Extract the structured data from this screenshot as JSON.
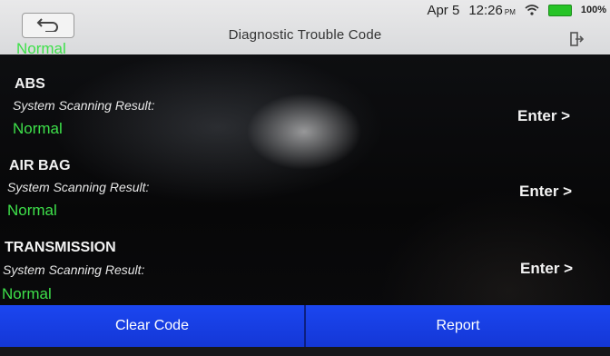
{
  "status_bar": {
    "date": "Apr 5",
    "time": "12:26",
    "ampm": "PM",
    "battery": "100%"
  },
  "header": {
    "title": "Diagnostic Trouble Code",
    "back_icon": "back-arrow-icon",
    "exit_icon": "exit-icon"
  },
  "partial_top_status": "Normal",
  "systems": [
    {
      "name": "ABS",
      "result_label": "System Scanning Result:",
      "result": "Normal",
      "action": "Enter >"
    },
    {
      "name": "AIR BAG",
      "result_label": "System Scanning Result:",
      "result": "Normal",
      "action": "Enter >"
    },
    {
      "name": "TRANSMISSION",
      "result_label": "System Scanning Result:",
      "result": "Normal",
      "action": "Enter >"
    }
  ],
  "footer": {
    "clear_code": "Clear Code",
    "report": "Report"
  },
  "colors": {
    "header_bg": "#e3e3e4",
    "status_green": "#3ee04a",
    "footer_blue": "#1a43ea"
  }
}
